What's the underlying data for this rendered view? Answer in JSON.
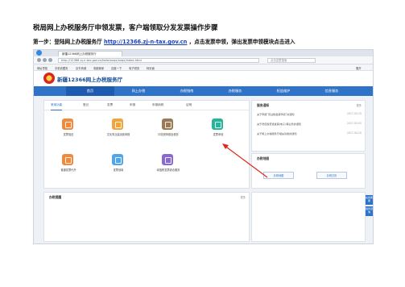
{
  "doc": {
    "title": "税局网上办税服务厅申领发票，客户端领取分发发票操作步骤",
    "step1_prefix": "第一步：登陆网上办税服务厅 ",
    "step1_url": "http://12366.zj-n-tax.gov.cn",
    "step1_suffix": "，点击发票申领，弹出发票申领模块点击进入"
  },
  "browser": {
    "tab_title": "新疆12366网上办税服务厅",
    "url": "http://12366.xj-n-tax.gov.cn/bsfw/xxqx/xxqx/index.html",
    "search_placeholder": "点击这里搜索",
    "bookmarks": [
      "网址导航",
      "手机收藏夹",
      "京东商城",
      "电脑管家",
      "百度一下",
      "电子税务",
      "转页面"
    ],
    "bookmark_right": "展开"
  },
  "site": {
    "title": "新疆12366网上办税服务厅",
    "nav": [
      "首页",
      "网上办税",
      "办税指南",
      "办税服务",
      "权益维护",
      "信息服务"
    ]
  },
  "main": {
    "subtabs": [
      "常用功能",
      "登记",
      "发票",
      "申报",
      "申报纳税",
      "证明"
    ],
    "tiles": [
      {
        "label": "发票验旧",
        "color": "#f08a3c"
      },
      {
        "label": "文化事业建设费申报",
        "color": "#f0a53c"
      },
      {
        "label": "印花税申报及税务",
        "color": "#9a7b55"
      },
      {
        "label": "发票申领",
        "color": "#27b59a"
      },
      {
        "label": "普通发票代开",
        "color": "#f08a3c"
      },
      {
        "label": "发票领用",
        "color": "#4fa6e8"
      },
      {
        "label": "增值税发票综合服务",
        "color": "#8a6ad0"
      }
    ]
  },
  "notice": {
    "title": "服务通知",
    "more": "更多",
    "rows": [
      {
        "text": "关于申报“营业税发票申领”的通知",
        "date": "2017-05-15"
      },
      {
        "text": "关于增值税普通发票(电子)等业务的通知",
        "date": "2017-05-05"
      },
      {
        "text": "关于网上办税服务厅相关功能的通知",
        "date": "2017-04-20"
      }
    ]
  },
  "handle": {
    "title": "办税地图",
    "btn1": "办税地图",
    "btn2": "办税日历"
  },
  "side_float": [
    "在线客服",
    "税务咨询"
  ],
  "lower": {
    "title": "办税提醒",
    "more": "更多"
  }
}
